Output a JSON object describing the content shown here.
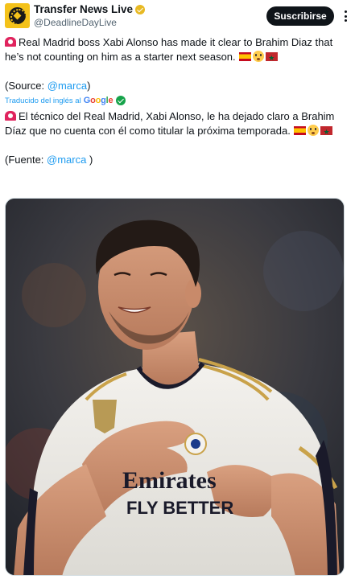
{
  "account": {
    "display_name": "Transfer News Live",
    "handle": "@DeadlineDayLive",
    "subscribe_label": "Suscribirse"
  },
  "tweet": {
    "original_line1": "Real Madrid boss Xabi Alonso has made it clear to Brahim Diaz that he’s not counting on him as a starter next season.",
    "source_prefix": "(Source: ",
    "source_mention": "@marca",
    "source_suffix": ")",
    "translated_label": "Traducido del inglés al",
    "translated_by": "Google",
    "translated_line1": "El técnico del Real Madrid, Xabi Alonso, le ha dejado claro a Brahim Díaz que no cuenta con él como titular la próxima temporada.",
    "fuente_prefix": "(Fuente: ",
    "fuente_mention": "@marca",
    "fuente_suffix": " )"
  },
  "media": {
    "shirt_text_1": "Emirates",
    "shirt_text_2": "FLY BETTER"
  },
  "icons": {
    "avatar": "football-icon",
    "verified": "verified-badge-icon",
    "more": "more-options-icon",
    "siren": "siren-emoji",
    "flag_spain": "spain-flag-emoji",
    "flag_morocco": "morocco-flag-emoji",
    "flushed": "flushed-face-emoji",
    "check": "check-circle-icon"
  },
  "colors": {
    "link": "#1d9bf0",
    "button_bg": "#0f1419",
    "avatar_bg": "#f4c21a"
  }
}
